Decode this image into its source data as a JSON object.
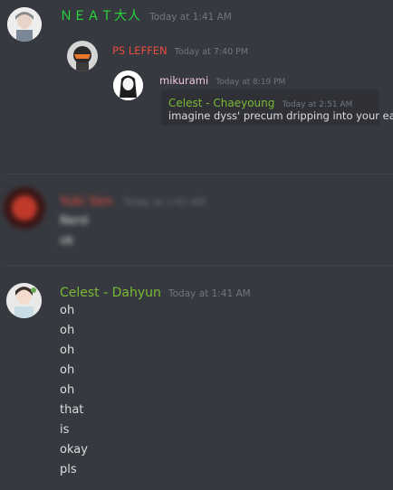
{
  "msg1": {
    "author": "ＮＥＡＴ大人",
    "timestamp": "Today at 1:41 AM",
    "author_color": "#27d83a"
  },
  "nested1": {
    "author": "PS LEFFEN",
    "timestamp": "Today at 7:40 PM",
    "author_color": "#e84c3d"
  },
  "nested2": {
    "author": "mikurami",
    "timestamp": "Today at 8:19 PM",
    "quote": {
      "author": "Celest - Chaeyoung",
      "timestamp": "Today at 2:51 AM",
      "text": "imagine dyss' precum dripping into your ear",
      "author_color": "#7bb934"
    }
  },
  "msg2": {
    "author": "Yuki Sen",
    "timestamp": "Today at 1:41 AM",
    "lines": [
      "Nerd",
      "ok"
    ],
    "author_color": "#e84c3d"
  },
  "msg3": {
    "author": "Celest - Dahyun",
    "timestamp": "Today at 1:41 AM",
    "author_color": "#7bb934",
    "lines": [
      "oh",
      "oh",
      "oh",
      "oh",
      "oh",
      "that",
      "is",
      "okay",
      "pls"
    ]
  }
}
